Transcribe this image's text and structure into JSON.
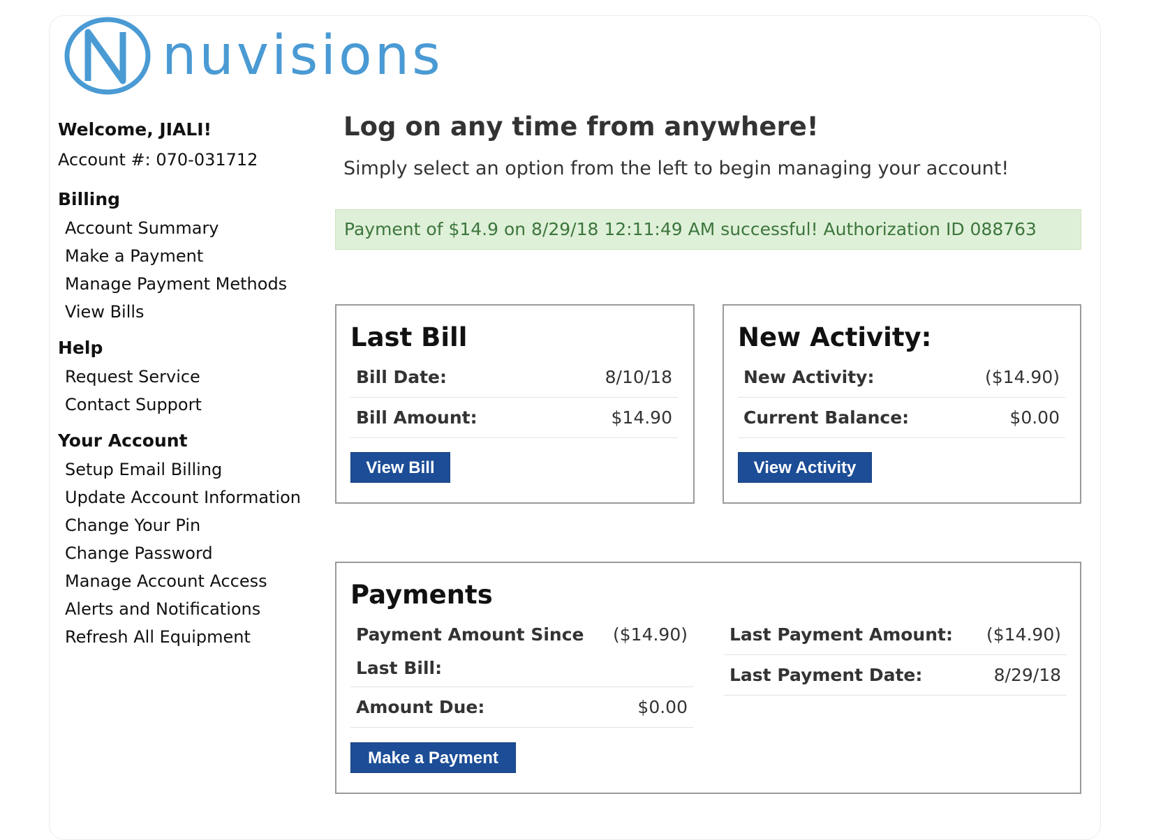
{
  "brand": {
    "logo_text": "nuvisions",
    "logo_color": "#4a9ad4"
  },
  "sidebar": {
    "welcome": "Welcome, JIALI!",
    "account_number": "Account #: 070-031712",
    "sections": [
      {
        "heading": "Billing",
        "items": [
          "Account Summary",
          "Make a Payment",
          "Manage Payment Methods",
          "View Bills"
        ]
      },
      {
        "heading": "Help",
        "items": [
          "Request Service",
          "Contact Support"
        ]
      },
      {
        "heading": "Your Account",
        "items": [
          "Setup Email Billing",
          "Update Account Information",
          "Change Your Pin",
          "Change Password",
          "Manage Account Access",
          "Alerts and Notifications",
          "Refresh All Equipment"
        ]
      }
    ]
  },
  "main": {
    "headline": "Log on any time from anywhere!",
    "subhead": "Simply select an option from the left to begin managing your account!",
    "alert": "Payment of $14.9 on 8/29/18 12:11:49 AM successful! Authorization ID 088763",
    "last_bill": {
      "title": "Last Bill",
      "rows": [
        {
          "label": "Bill Date:",
          "value": "8/10/18"
        },
        {
          "label": "Bill Amount:",
          "value": "$14.90"
        }
      ],
      "button": "View Bill"
    },
    "new_activity": {
      "title": "New Activity:",
      "rows": [
        {
          "label": "New Activity:",
          "value": "($14.90)"
        },
        {
          "label": "Current Balance:",
          "value": "$0.00"
        }
      ],
      "button": "View Activity"
    },
    "payments": {
      "title": "Payments",
      "left_rows": [
        {
          "label_line1": "Payment Amount Since",
          "label_line2": "Last Bill:",
          "value": "($14.90)"
        },
        {
          "label": "Amount Due:",
          "value": "$0.00"
        }
      ],
      "right_rows": [
        {
          "label": "Last Payment Amount:",
          "value": "($14.90)"
        },
        {
          "label": "Last Payment Date:",
          "value": "8/29/18"
        }
      ],
      "button": "Make a Payment"
    }
  },
  "colors": {
    "button": "#1c4d96",
    "alert_bg": "#dff0d8",
    "alert_text": "#3c763d"
  }
}
